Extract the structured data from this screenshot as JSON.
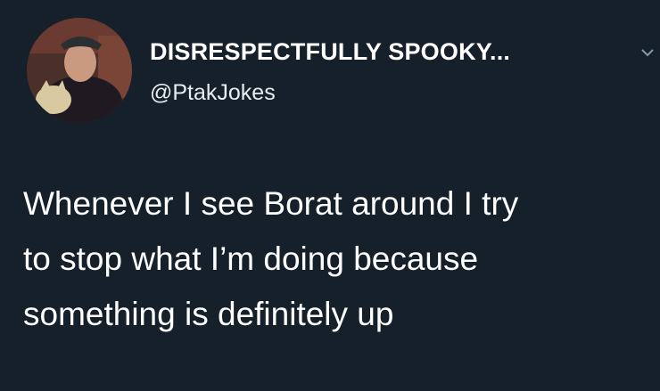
{
  "tweet": {
    "display_name": "DISRESPECTFULLY SPOOKY...",
    "handle": "@PtakJokes",
    "text_lines": [
      "Whenever I see Borat around I try",
      "to stop what I’m doing because",
      "something is definitely up"
    ]
  },
  "icons": {
    "menu": "chevron-down-icon",
    "avatar": "profile-avatar"
  },
  "colors": {
    "background": "#15202b",
    "text": "#ffffff"
  }
}
